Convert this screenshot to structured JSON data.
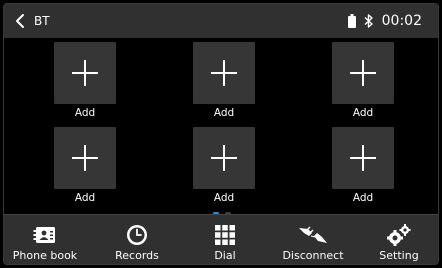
{
  "header": {
    "title": "BT",
    "time": "00:02",
    "back_icon": "chevron-left-icon",
    "battery_icon": "phone-battery-icon",
    "bluetooth_icon": "bluetooth-icon"
  },
  "grid": {
    "tiles": [
      {
        "label": "Add",
        "icon": "plus-icon"
      },
      {
        "label": "Add",
        "icon": "plus-icon"
      },
      {
        "label": "Add",
        "icon": "plus-icon"
      },
      {
        "label": "Add",
        "icon": "plus-icon"
      },
      {
        "label": "Add",
        "icon": "plus-icon"
      },
      {
        "label": "Add",
        "icon": "plus-icon"
      }
    ]
  },
  "pager": {
    "pages": 2,
    "current": 1,
    "active_color": "#1e88e5",
    "inactive_color": "#3a3a3a"
  },
  "bottom_nav": {
    "items": [
      {
        "label": "Phone book",
        "icon": "contacts-book-icon"
      },
      {
        "label": "Records",
        "icon": "clock-icon"
      },
      {
        "label": "Dial",
        "icon": "dialpad-icon"
      },
      {
        "label": "Disconnect",
        "icon": "unplugged-icon"
      },
      {
        "label": "Setting",
        "icon": "gears-icon"
      }
    ]
  }
}
